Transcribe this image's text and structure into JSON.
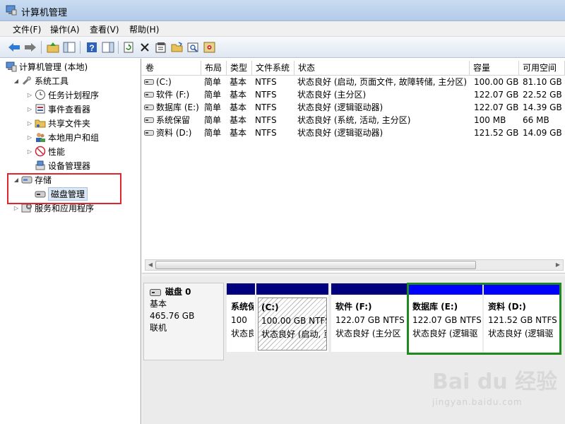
{
  "window": {
    "title": "计算机管理"
  },
  "menu": [
    "文件(F)",
    "操作(A)",
    "查看(V)",
    "帮助(H)"
  ],
  "toolbar": [
    "back-icon",
    "forward-icon",
    "up-folder-icon",
    "show-hide-tree-icon",
    "help-icon",
    "panel-icon",
    "refresh-icon",
    "delete-icon",
    "properties-icon",
    "open-folder-icon",
    "search-icon",
    "settings-icon"
  ],
  "tree": {
    "root": "计算机管理 (本地)",
    "system_tools": "系统工具",
    "task_scheduler": "任务计划程序",
    "event_viewer": "事件查看器",
    "shared_folders": "共享文件夹",
    "local_users": "本地用户和组",
    "performance": "性能",
    "device_manager": "设备管理器",
    "storage": "存储",
    "disk_management": "磁盘管理",
    "services_apps": "服务和应用程序"
  },
  "table": {
    "columns": [
      "卷",
      "布局",
      "类型",
      "文件系统",
      "状态",
      "容量",
      "可用空间"
    ],
    "rows": [
      [
        "(C:)",
        "简单",
        "基本",
        "NTFS",
        "状态良好 (启动, 页面文件, 故障转储, 主分区)",
        "100.00 GB",
        "81.10 GB"
      ],
      [
        "软件 (F:)",
        "简单",
        "基本",
        "NTFS",
        "状态良好 (主分区)",
        "122.07 GB",
        "22.52 GB"
      ],
      [
        "数据库 (E:)",
        "简单",
        "基本",
        "NTFS",
        "状态良好 (逻辑驱动器)",
        "122.07 GB",
        "14.39 GB"
      ],
      [
        "系统保留",
        "简单",
        "基本",
        "NTFS",
        "状态良好 (系统, 活动, 主分区)",
        "100 MB",
        "66 MB"
      ],
      [
        "资料 (D:)",
        "简单",
        "基本",
        "NTFS",
        "状态良好 (逻辑驱动器)",
        "121.52 GB",
        "14.09 GB"
      ]
    ]
  },
  "disk": {
    "name": "磁盘 0",
    "type": "基本",
    "size": "465.76 GB",
    "status": "联机",
    "partitions": [
      {
        "name": "系统保",
        "size": "100",
        "status": "状态良",
        "bar_color": "#00007f"
      },
      {
        "name": "(C:)",
        "size": "100.00 GB NTFS",
        "status": "状态良好 (启动, 页",
        "bar_color": "#00007f"
      },
      {
        "name": "软件  (F:)",
        "size": "122.07 GB NTFS",
        "status": "状态良好 (主分区",
        "bar_color": "#00007f"
      },
      {
        "name": "数据库  (E:)",
        "size": "122.07 GB NTFS",
        "status": "状态良好 (逻辑驱",
        "bar_color": "#0000ff"
      },
      {
        "name": "资料  (D:)",
        "size": "121.52 GB NTFS",
        "status": "状态良好 (逻辑驱",
        "bar_color": "#0000ff"
      }
    ]
  },
  "watermark": {
    "text": "Bai du 经验",
    "url": "jingyan.baidu.com"
  }
}
